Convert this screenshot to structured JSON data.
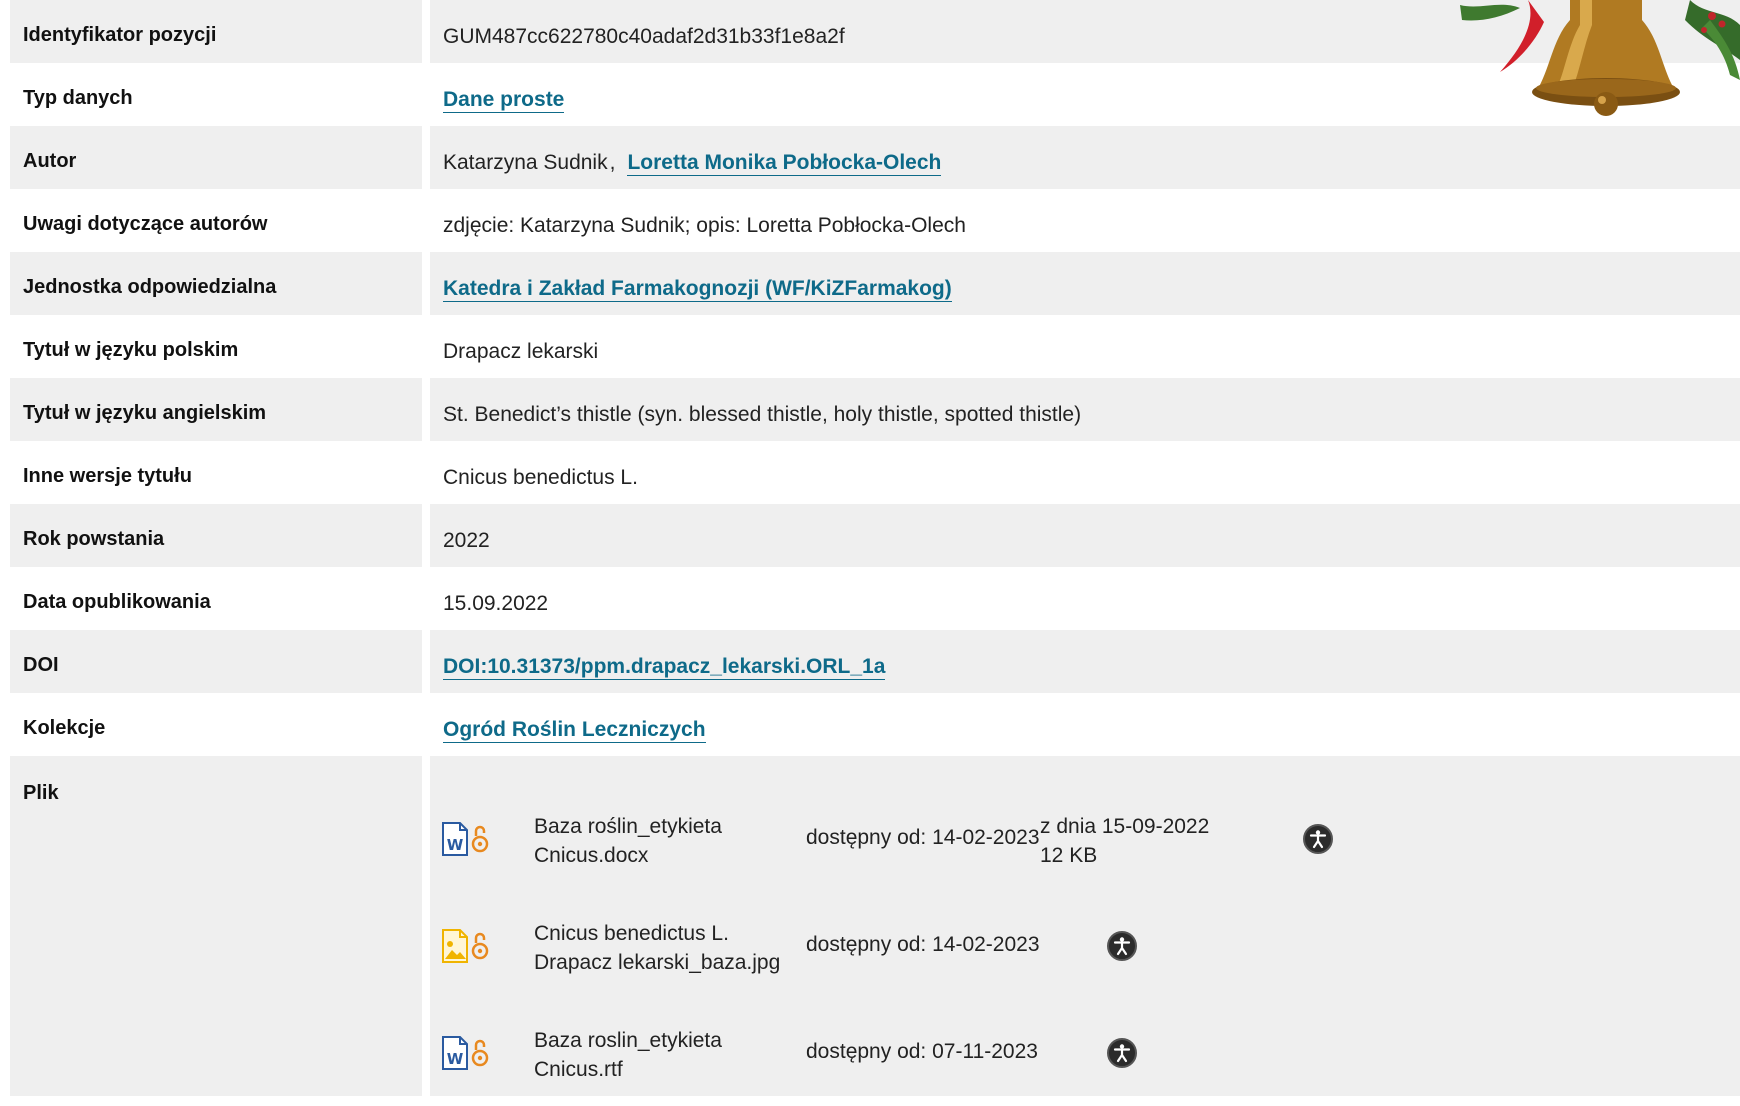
{
  "rows": [
    {
      "label": "Identyfikator pozycji",
      "value": "GUM487cc622780c40adaf2d31b33f1e8a2f"
    },
    {
      "label": "Typ danych",
      "value": "Dane proste"
    },
    {
      "label": "Autor",
      "value_plain": "Katarzyna Sudnik",
      "value_sep": ",",
      "value_link": "Loretta Monika Pobłocka-Olech"
    },
    {
      "label": "Uwagi dotyczące autorów",
      "value": "zdjęcie: Katarzyna Sudnik; opis: Loretta Pobłocka-Olech"
    },
    {
      "label": "Jednostka odpowiedzialna",
      "value": "Katedra i Zakład Farmakognozji (WF/KiZFarmakog)"
    },
    {
      "label": "Tytuł w języku polskim",
      "value": "Drapacz lekarski"
    },
    {
      "label": "Tytuł w języku angielskim",
      "value": "St. Benedict’s thistle (syn. blessed thistle, holy thistle, spotted thistle)"
    },
    {
      "label": "Inne wersje tytułu",
      "value": "Cnicus benedictus L."
    },
    {
      "label": "Rok powstania",
      "value": "2022"
    },
    {
      "label": "Data opublikowania",
      "value": "15.09.2022"
    },
    {
      "label": "DOI",
      "value": "DOI:10.31373/ppm.drapacz_lekarski.ORL_1a"
    },
    {
      "label": "Kolekcje",
      "value": "Ogród Roślin Leczniczych"
    },
    {
      "label": "Plik"
    }
  ],
  "files": [
    {
      "type_icon": "word-document-icon",
      "name_line1": "Baza roślin_etykieta",
      "name_line2": "Cnicus.docx",
      "available": "dostępny od: 14-02-2023",
      "date": "z dnia 15-09-2022",
      "size": "12 KB"
    },
    {
      "type_icon": "image-file-icon",
      "name_line1": "Cnicus benedictus L.",
      "name_line2": "Drapacz lekarski_baza.jpg",
      "available": "dostępny od: 14-02-2023"
    },
    {
      "type_icon": "word-document-icon",
      "name_line1": "Baza roslin_etykieta",
      "name_line2": "Cnicus.rtf",
      "available": "dostępny od: 07-11-2023"
    }
  ],
  "colors": {
    "link": "#0e6a89",
    "row_alt": "#efefef",
    "open_access": "#e8891f"
  }
}
